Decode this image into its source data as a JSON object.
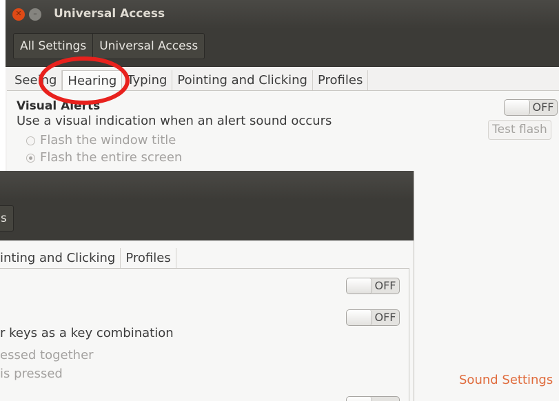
{
  "window_title": "Universal Access",
  "breadcrumbs": [
    "All Settings",
    "Universal Access"
  ],
  "tabs": [
    "Seeing",
    "Hearing",
    "Typing",
    "Pointing and Clicking",
    "Profiles"
  ],
  "visual_alerts": {
    "heading": "Visual Alerts",
    "description": "Use a visual indication when an alert sound occurs",
    "toggle": "OFF",
    "test_flash": "Test flash",
    "options": [
      "Flash the window title",
      "Flash the entire screen"
    ],
    "selected_option": 1
  },
  "sound_settings_link": "Sound Settings",
  "front_window": {
    "breadcrumb_fragment": "s",
    "tabs": [
      "inting and Clicking",
      "Profiles"
    ],
    "toggles": [
      "OFF",
      "OFF"
    ],
    "description_fragment": "r keys as a key combination",
    "option_fragments": [
      "essed together",
      "is pressed"
    ]
  },
  "colors": {
    "titlebar": "#3c3b37",
    "window_bg": "#f2f1f0",
    "close_button": "#df4a16",
    "link": "#e06c3d",
    "highlight_circle": "#e8211d"
  }
}
